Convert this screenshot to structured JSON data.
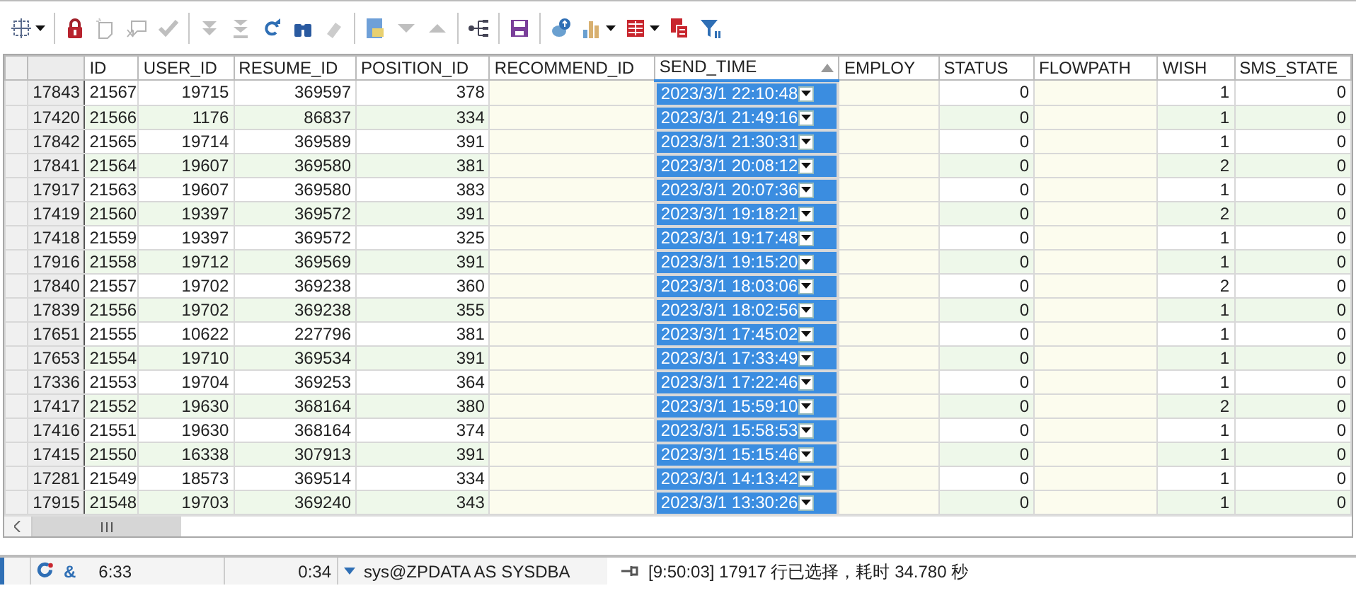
{
  "toolbar": [
    {
      "kind": "grid",
      "disabled": false,
      "dropdown": true
    },
    {
      "kind": "separator"
    },
    {
      "kind": "lock",
      "disabled": false
    },
    {
      "kind": "new-record",
      "disabled": true
    },
    {
      "kind": "delete-record",
      "disabled": true
    },
    {
      "kind": "check",
      "disabled": true
    },
    {
      "kind": "separator"
    },
    {
      "kind": "fetch-next",
      "disabled": true
    },
    {
      "kind": "fetch-last",
      "disabled": true
    },
    {
      "kind": "refresh",
      "disabled": false
    },
    {
      "kind": "find",
      "disabled": false
    },
    {
      "kind": "clear",
      "disabled": true
    },
    {
      "kind": "separator"
    },
    {
      "kind": "form",
      "disabled": false
    },
    {
      "kind": "down",
      "disabled": true
    },
    {
      "kind": "up",
      "disabled": true
    },
    {
      "kind": "separator"
    },
    {
      "kind": "tree",
      "disabled": false
    },
    {
      "kind": "separator"
    },
    {
      "kind": "save",
      "disabled": false
    },
    {
      "kind": "separator"
    },
    {
      "kind": "export",
      "disabled": false
    },
    {
      "kind": "chart",
      "disabled": false,
      "dropdown": true
    },
    {
      "kind": "table",
      "disabled": false,
      "dropdown": true
    },
    {
      "kind": "copy",
      "disabled": false
    },
    {
      "kind": "filter",
      "disabled": false
    }
  ],
  "table": {
    "columns": [
      {
        "title": "ID",
        "kind": "number",
        "selected": false,
        "sorted": false
      },
      {
        "title": "USER_ID",
        "kind": "number",
        "selected": false,
        "sorted": false
      },
      {
        "title": "RESUME_ID",
        "kind": "number",
        "selected": false,
        "sorted": false
      },
      {
        "title": "POSITION_ID",
        "kind": "number",
        "selected": false,
        "sorted": false
      },
      {
        "title": "RECOMMEND_ID",
        "kind": "empty",
        "selected": false,
        "sorted": false
      },
      {
        "title": "SEND_TIME",
        "kind": "date",
        "selected": true,
        "sorted": true
      },
      {
        "title": "EMPLOY",
        "kind": "empty",
        "selected": false,
        "sorted": false
      },
      {
        "title": "STATUS",
        "kind": "number",
        "selected": false,
        "sorted": false
      },
      {
        "title": "FLOWPATH",
        "kind": "empty",
        "selected": false,
        "sorted": false
      },
      {
        "title": "WISH",
        "kind": "number",
        "selected": false,
        "sorted": false
      },
      {
        "title": "SMS_STATE",
        "kind": "number",
        "selected": false,
        "sorted": false
      }
    ],
    "rows": [
      {
        "row_number": "17843",
        "values": [
          "21567",
          "19715",
          "369597",
          "378",
          "2023/3/1 22:10:48",
          "0",
          "1",
          "0"
        ]
      },
      {
        "row_number": "17420",
        "values": [
          "21566",
          "1176",
          "86837",
          "334",
          "2023/3/1 21:49:16",
          "0",
          "1",
          "0"
        ]
      },
      {
        "row_number": "17842",
        "values": [
          "21565",
          "19714",
          "369589",
          "391",
          "2023/3/1 21:30:31",
          "0",
          "1",
          "0"
        ]
      },
      {
        "row_number": "17841",
        "values": [
          "21564",
          "19607",
          "369580",
          "381",
          "2023/3/1 20:08:12",
          "0",
          "2",
          "0"
        ]
      },
      {
        "row_number": "17917",
        "values": [
          "21563",
          "19607",
          "369580",
          "383",
          "2023/3/1 20:07:36",
          "0",
          "1",
          "0"
        ]
      },
      {
        "row_number": "17419",
        "values": [
          "21560",
          "19397",
          "369572",
          "391",
          "2023/3/1 19:18:21",
          "0",
          "2",
          "0"
        ]
      },
      {
        "row_number": "17418",
        "values": [
          "21559",
          "19397",
          "369572",
          "325",
          "2023/3/1 19:17:48",
          "0",
          "1",
          "0"
        ]
      },
      {
        "row_number": "17916",
        "values": [
          "21558",
          "19712",
          "369569",
          "391",
          "2023/3/1 19:15:20",
          "0",
          "1",
          "0"
        ]
      },
      {
        "row_number": "17840",
        "values": [
          "21557",
          "19702",
          "369238",
          "360",
          "2023/3/1 18:03:06",
          "0",
          "2",
          "0"
        ]
      },
      {
        "row_number": "17839",
        "values": [
          "21556",
          "19702",
          "369238",
          "355",
          "2023/3/1 18:02:56",
          "0",
          "1",
          "0"
        ]
      },
      {
        "row_number": "17651",
        "values": [
          "21555",
          "10622",
          "227796",
          "381",
          "2023/3/1 17:45:02",
          "0",
          "1",
          "0"
        ]
      },
      {
        "row_number": "17653",
        "values": [
          "21554",
          "19710",
          "369534",
          "391",
          "2023/3/1 17:33:49",
          "0",
          "1",
          "0"
        ]
      },
      {
        "row_number": "17336",
        "values": [
          "21553",
          "19704",
          "369253",
          "364",
          "2023/3/1 17:22:46",
          "0",
          "1",
          "0"
        ]
      },
      {
        "row_number": "17417",
        "values": [
          "21552",
          "19630",
          "368164",
          "380",
          "2023/3/1 15:59:10",
          "0",
          "2",
          "0"
        ]
      },
      {
        "row_number": "17416",
        "values": [
          "21551",
          "19630",
          "368164",
          "374",
          "2023/3/1 15:58:53",
          "0",
          "1",
          "0"
        ]
      },
      {
        "row_number": "17415",
        "values": [
          "21550",
          "16338",
          "307913",
          "391",
          "2023/3/1 15:15:46",
          "0",
          "1",
          "0"
        ]
      },
      {
        "row_number": "17281",
        "values": [
          "21549",
          "18573",
          "369514",
          "334",
          "2023/3/1 14:13:42",
          "0",
          "1",
          "0"
        ]
      },
      {
        "row_number": "17915",
        "values": [
          "21548",
          "19703",
          "369240",
          "343",
          "2023/3/1 13:30:26",
          "0",
          "1",
          "0"
        ]
      }
    ]
  },
  "status_bar": {
    "symbol": "&",
    "cursor": "6:33",
    "elapsed": "0:34",
    "session": "sys@ZPDATA AS SYSDBA",
    "message": "[9:50:03] 17917 行已选择，耗时 34.780 秒"
  }
}
